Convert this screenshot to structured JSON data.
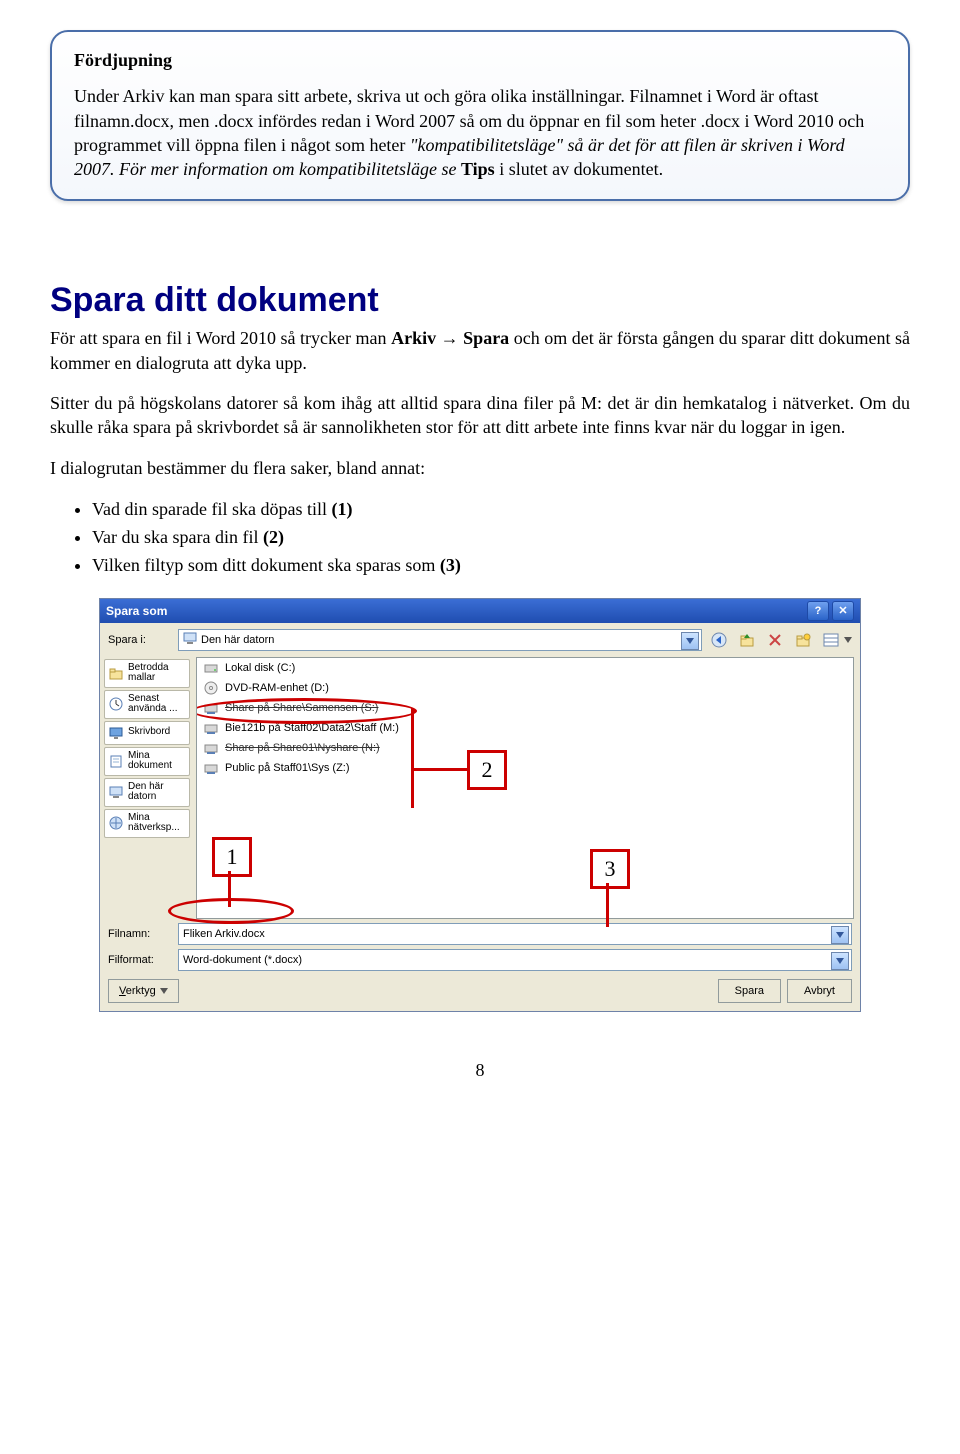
{
  "infobox": {
    "title": "Fördjupning",
    "body": "Under Arkiv kan man spara sitt arbete, skriva ut och göra olika inställningar. Filnamnet i Word är oftast filnamn.docx, men .docx infördes redan i Word 2007 så om du öppnar en fil som heter .docx i Word 2010 och programmet vill öppna filen i något som heter \"kompatibilitetsläge\" så är det för att filen är skriven i Word 2007. För mer information om kompatibilitetsläge se Tips i slutet av dokumentet."
  },
  "heading": "Spara ditt dokument",
  "para1_a": "För att spara en fil i Word 2010 så trycker man ",
  "para1_b": "Arkiv",
  "para1_c": " → ",
  "para1_d": "Spara",
  "para1_e": " och om det är första gången du sparar ditt dokument så kommer en dialogruta att dyka upp.",
  "para2": "Sitter du på högskolans datorer så kom ihåg att alltid spara dina filer på M: det är din hemkatalog i nätverket. Om du skulle råka spara på skrivbordet så är sannolikheten stor för att ditt arbete inte finns kvar när du loggar in igen.",
  "para3": "I dialogrutan bestämmer du flera saker, bland annat:",
  "bullets": [
    "Vad din sparade fil ska döpas till (1)",
    "Var du ska spara din fil (2)",
    "Vilken filtyp som ditt dokument ska sparas som (3)"
  ],
  "dialog": {
    "title": "Spara som",
    "spara_i_label": "Spara i:",
    "spara_i_value": "Den här datorn",
    "places": [
      "Betrodda mallar",
      "Senast använda ...",
      "Skrivbord",
      "Mina dokument",
      "Den här datorn",
      "Mina nätverksp..."
    ],
    "files": [
      "Lokal disk (C:)",
      "DVD-RAM-enhet (D:)",
      "Share på Share\\Samensen (S:)",
      "Bie121b på Staff02\\Data2\\Staff (M:)",
      "Share på Share01\\Nyshare (N:)",
      "Public på Staff01\\Sys (Z:)"
    ],
    "filnamn_label": "Filnamn:",
    "filnamn_value": "Fliken Arkiv.docx",
    "filformat_label": "Filformat:",
    "filformat_value": "Word-dokument (*.docx)",
    "tools": "Verktyg",
    "spara_btn": "Spara",
    "avbryt_btn": "Avbryt",
    "ann1": "1",
    "ann2": "2",
    "ann3": "3"
  },
  "pagenum": "8"
}
